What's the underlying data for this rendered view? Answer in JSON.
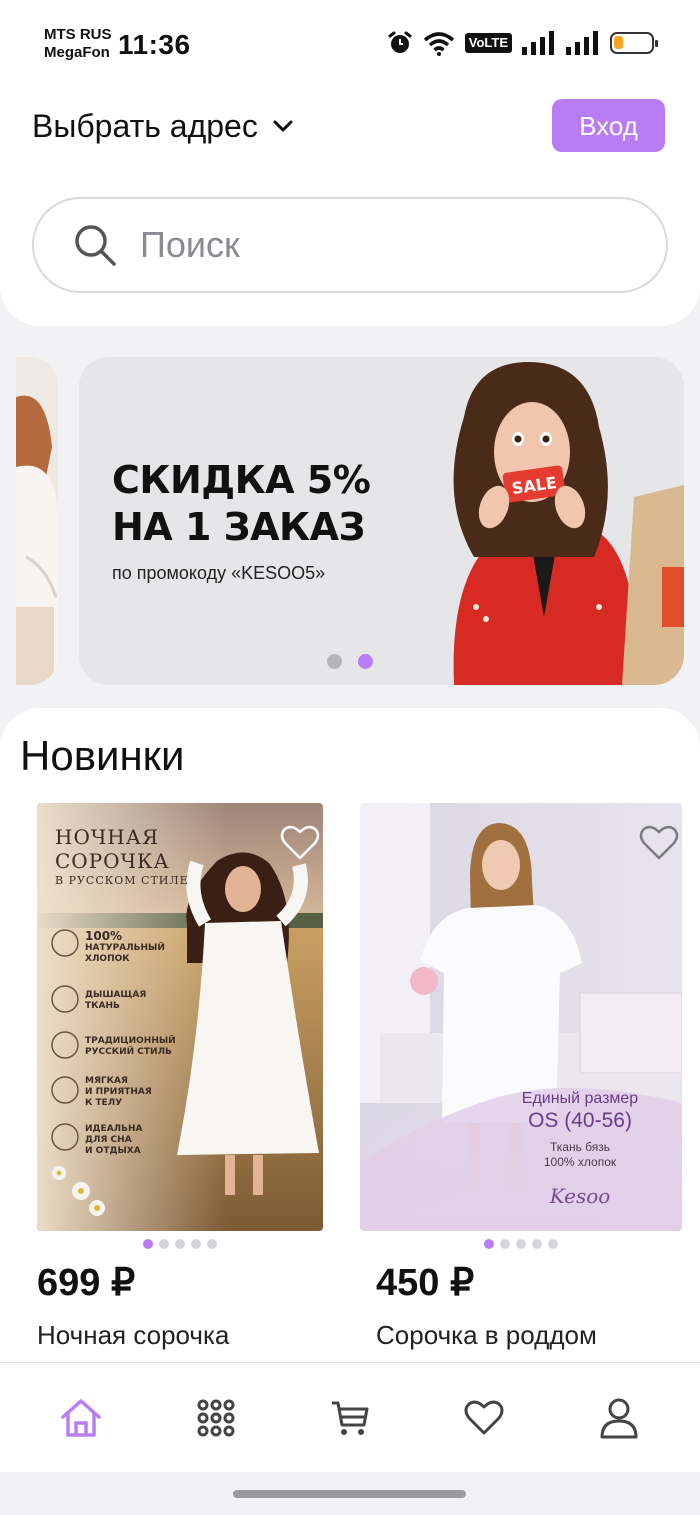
{
  "status_bar": {
    "carrier_1": "MTS RUS",
    "carrier_2": "MegaFon",
    "time": "11:36",
    "volte": "VoLTE",
    "battery_level": 0.25,
    "battery_color": "#f5a623"
  },
  "header": {
    "address_label": "Выбрать адрес",
    "login_label": "Вход",
    "accent_color": "#b87cf5"
  },
  "search": {
    "placeholder": "Поиск"
  },
  "banner": {
    "title_line1": "СКИДКА 5%",
    "title_line2": "НА 1 ЗАКАЗ",
    "subtitle": "по промокоду «KESOO5»",
    "sale_tag": "SALE",
    "active_slide": 2,
    "slide_count": 2
  },
  "new_arrivals": {
    "title": "Новинки",
    "products": [
      {
        "price": "699 ₽",
        "name": "Ночная сорочка",
        "image_text": {
          "heading_1": "НОЧНАЯ",
          "heading_2": "СОРОЧКА",
          "heading_3": "В РУССКОМ СТИЛЕ",
          "f1": "100%",
          "f1b": "НАТУРАЛЬНЫЙ",
          "f1c": "ХЛОПОК",
          "f2": "ДЫШАЩАЯ",
          "f2b": "ТКАНЬ",
          "f3": "ТРАДИЦИОННЫЙ",
          "f3b": "РУССКИЙ СТИЛЬ",
          "f4": "МЯГКАЯ",
          "f4b": "И ПРИЯТНАЯ",
          "f4c": "К ТЕЛУ",
          "f5": "ИДЕАЛЬНА",
          "f5b": "ДЛЯ СНА",
          "f5c": "И ОТДЫХА"
        },
        "image_count": 5,
        "active_image": 1
      },
      {
        "price": "450 ₽",
        "name": "Сорочка в роддом",
        "image_text": {
          "size_line": "Единый размер",
          "size_value": "OS (40-56)",
          "fabric_1": "Ткань бязь",
          "fabric_2": "100% хлопок",
          "brand": "Kesoo"
        },
        "image_count": 5,
        "active_image": 1
      }
    ]
  },
  "bottom_nav": [
    "home-icon",
    "catalog-icon",
    "cart-icon",
    "favorites-icon",
    "profile-icon"
  ]
}
